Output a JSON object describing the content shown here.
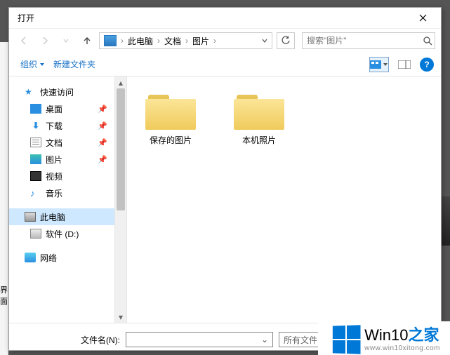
{
  "window": {
    "title": "打开"
  },
  "nav": {
    "breadcrumbs": [
      "此电脑",
      "文档",
      "图片"
    ],
    "search_placeholder": "搜索\"图片\""
  },
  "toolbar": {
    "organize": "组织",
    "new_folder": "新建文件夹",
    "help": "?"
  },
  "sidebar": {
    "quick_access": "快速访问",
    "items": [
      {
        "label": "桌面",
        "icon": "desktop",
        "pinned": true
      },
      {
        "label": "下载",
        "icon": "download",
        "pinned": true
      },
      {
        "label": "文档",
        "icon": "doc",
        "pinned": true
      },
      {
        "label": "图片",
        "icon": "pic",
        "pinned": true
      },
      {
        "label": "视频",
        "icon": "video",
        "pinned": false
      },
      {
        "label": "音乐",
        "icon": "music",
        "pinned": false
      }
    ],
    "this_pc": "此电脑",
    "drive": "软件 (D:)",
    "network": "网络"
  },
  "content": {
    "folders": [
      {
        "name": "保存的图片"
      },
      {
        "name": "本机照片"
      }
    ]
  },
  "footer": {
    "filename_label": "文件名(N):",
    "filter": "所有文件"
  },
  "watermark": {
    "brand_prefix": "Win10",
    "brand_suffix": "之家",
    "url": "www.win10xitong.com"
  },
  "behind_text": "界面"
}
